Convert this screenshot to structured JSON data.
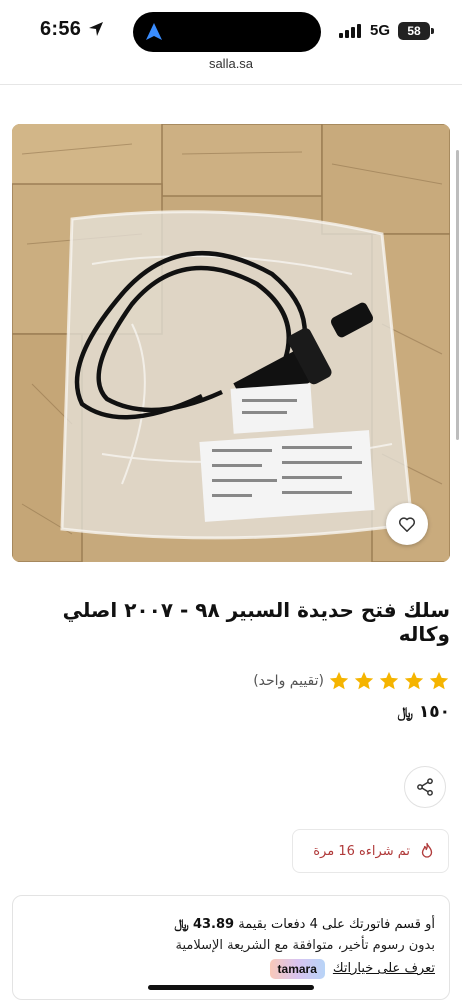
{
  "status_bar": {
    "time": "6:56",
    "network": "5G",
    "battery": "58"
  },
  "browser": {
    "url": "salla.sa"
  },
  "product": {
    "title": "سلك فتح حديدة السبير ٩٨ - ٢٠٠٧ اصلي وكاله",
    "rating_value": 5,
    "rating_count": "(تقييم واحد)",
    "price": "١٥٠",
    "currency_symbol": "﷼",
    "sold_text": "تم شراءه 16 مرة",
    "favorite_icon": "heart-icon",
    "share_icon": "share-icon"
  },
  "tamara": {
    "line1_prefix": "أو قسم فاتورتك على 4 دفعات بقيمة",
    "installment_amount": "43.89",
    "currency_symbol": "﷼",
    "line2": "بدون رسوم تأخير، متوافقة مع الشريعة الإسلامية",
    "learn_more": "تعرف على خياراتك",
    "logo_text": "tamara"
  },
  "colors": {
    "star": "#f5b400",
    "sold_text": "#b03a3a",
    "tamara_gradient": [
      "#f9c9b9",
      "#d8c4f0",
      "#b8d4f7"
    ]
  }
}
